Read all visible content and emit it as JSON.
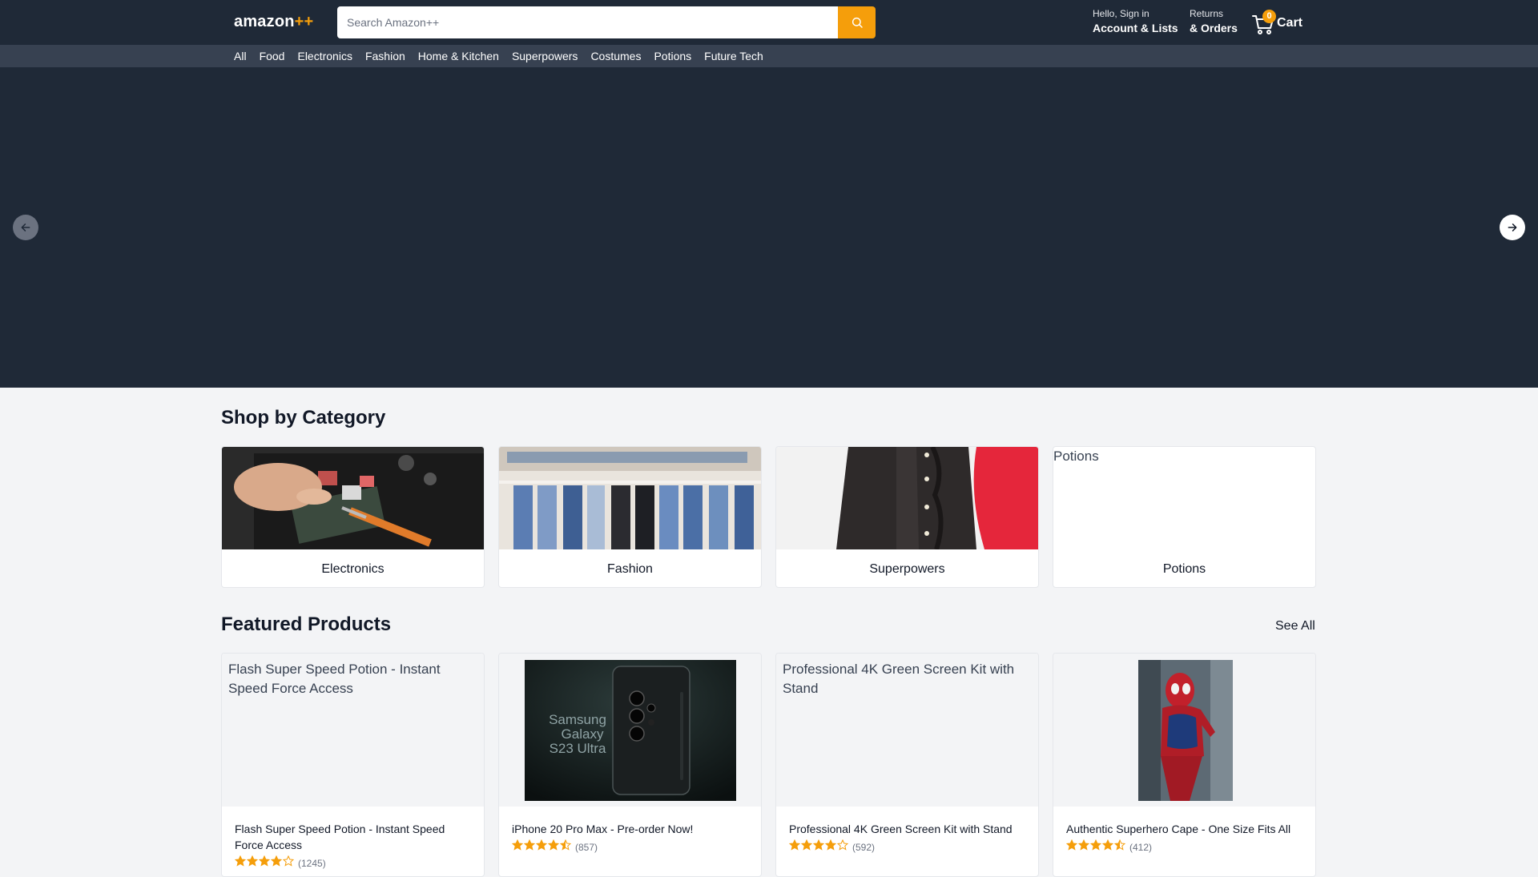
{
  "header": {
    "logo_text": "amazon",
    "logo_accent": "++",
    "search_placeholder": "Search Amazon++",
    "account_line1": "Hello, Sign in",
    "account_line2": "Account & Lists",
    "returns_line1": "Returns",
    "returns_line2": "& Orders",
    "cart_count": "0",
    "cart_label": "Cart"
  },
  "nav": {
    "items": [
      "All",
      "Food",
      "Electronics",
      "Fashion",
      "Home & Kitchen",
      "Superpowers",
      "Costumes",
      "Potions",
      "Future Tech"
    ]
  },
  "colors": {
    "header_bg": "#1f2937",
    "nav_bg": "#374151",
    "accent": "#f59e0b",
    "star": "#f59e0b"
  },
  "categories": {
    "title": "Shop by Category",
    "items": [
      {
        "label": "Electronics"
      },
      {
        "label": "Fashion"
      },
      {
        "label": "Superpowers"
      },
      {
        "label": "Potions",
        "alt": "Potions"
      }
    ]
  },
  "featured": {
    "title": "Featured Products",
    "see_all": "See All",
    "products": [
      {
        "title": "Flash Super Speed Potion - Instant Speed Force Access",
        "alt": "Flash Super Speed Potion - Instant Speed Force Access",
        "rating": 4,
        "reviews": "(1245)"
      },
      {
        "title": "iPhone 20 Pro Max - Pre-order Now!",
        "phone_text": [
          "Samsung",
          "Galaxy",
          "S23 Ultra"
        ],
        "rating": 4.5,
        "reviews": "(857)"
      },
      {
        "title": "Professional 4K Green Screen Kit with Stand",
        "alt": "Professional 4K Green Screen Kit with Stand",
        "rating": 4,
        "reviews": "(592)"
      },
      {
        "title": "Authentic Superhero Cape - One Size Fits All",
        "rating": 4.5,
        "reviews": "(412)"
      }
    ]
  }
}
